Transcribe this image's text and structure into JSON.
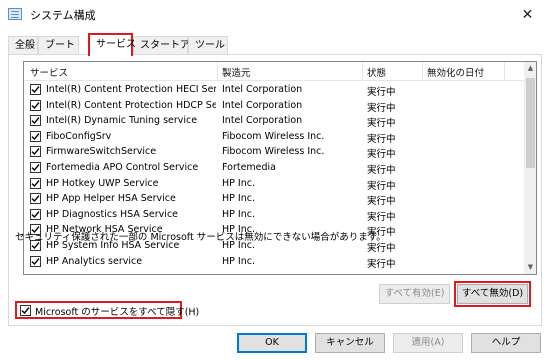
{
  "window": {
    "title": "システム構成",
    "close_glyph": "✕"
  },
  "tabs": [
    {
      "label": "全般"
    },
    {
      "label": "ブート"
    },
    {
      "label": "サービス"
    },
    {
      "label": "スタートアップ"
    },
    {
      "label": "ツール"
    }
  ],
  "columns": {
    "service": "サービス",
    "manufacturer": "製造元",
    "status": "状態",
    "disabled_date": "無効化の日付"
  },
  "services": [
    {
      "name": "Intel(R) Content Protection HECI Ser...",
      "maker": "Intel Corporation",
      "status": "実行中",
      "checked": true
    },
    {
      "name": "Intel(R) Content Protection HDCP Se...",
      "maker": "Intel Corporation",
      "status": "実行中",
      "checked": true
    },
    {
      "name": "Intel(R) Dynamic Tuning service",
      "maker": "Intel Corporation",
      "status": "実行中",
      "checked": true
    },
    {
      "name": "FiboConfigSrv",
      "maker": "Fibocom Wireless Inc.",
      "status": "実行中",
      "checked": true
    },
    {
      "name": "FirmwareSwitchService",
      "maker": "Fibocom Wireless Inc.",
      "status": "実行中",
      "checked": true
    },
    {
      "name": "Fortemedia APO Control Service",
      "maker": "Fortemedia",
      "status": "実行中",
      "checked": true
    },
    {
      "name": "HP Hotkey UWP Service",
      "maker": "HP Inc.",
      "status": "実行中",
      "checked": true
    },
    {
      "name": "HP App Helper HSA Service",
      "maker": "HP Inc.",
      "status": "実行中",
      "checked": true
    },
    {
      "name": "HP Diagnostics HSA Service",
      "maker": "HP Inc.",
      "status": "実行中",
      "checked": true
    },
    {
      "name": "HP Network HSA Service",
      "maker": "HP Inc.",
      "status": "実行中",
      "checked": true
    },
    {
      "name": "HP System Info HSA Service",
      "maker": "HP Inc.",
      "status": "実行中",
      "checked": true
    },
    {
      "name": "HP Analytics service",
      "maker": "HP Inc.",
      "status": "実行中",
      "checked": true
    }
  ],
  "notice": "セキュリティ保護された一部の Microsoft サービスは無効にできない場合があります。",
  "buttons": {
    "enable_all": "すべて有効(E)",
    "disable_all": "すべて無効(D)",
    "ok": "OK",
    "cancel": "キャンセル",
    "apply": "適用(A)",
    "help": "ヘルプ"
  },
  "hide_microsoft": {
    "label": "Microsoft のサービスをすべて隠す(H)",
    "checked": true
  },
  "icons": {
    "scroll_up": "▲",
    "scroll_down": "▼"
  },
  "colors": {
    "highlight": "#e0191e",
    "focus": "#0078d7"
  }
}
